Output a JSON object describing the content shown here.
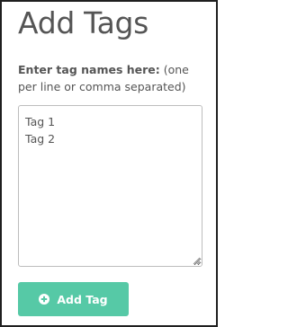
{
  "dialog": {
    "title": "Add Tags",
    "instructions_bold": "Enter tag names here:",
    "instructions_rest": " (one per line or comma separated)"
  },
  "tag_input": {
    "value": "Tag 1\nTag 2",
    "placeholder": ""
  },
  "add_button": {
    "icon": "plus-circle-icon",
    "label": "Add Tag"
  },
  "colors": {
    "button_background": "#56c9a6",
    "button_text": "#ffffff",
    "text": "#555555",
    "border": "#1f1f1f"
  }
}
